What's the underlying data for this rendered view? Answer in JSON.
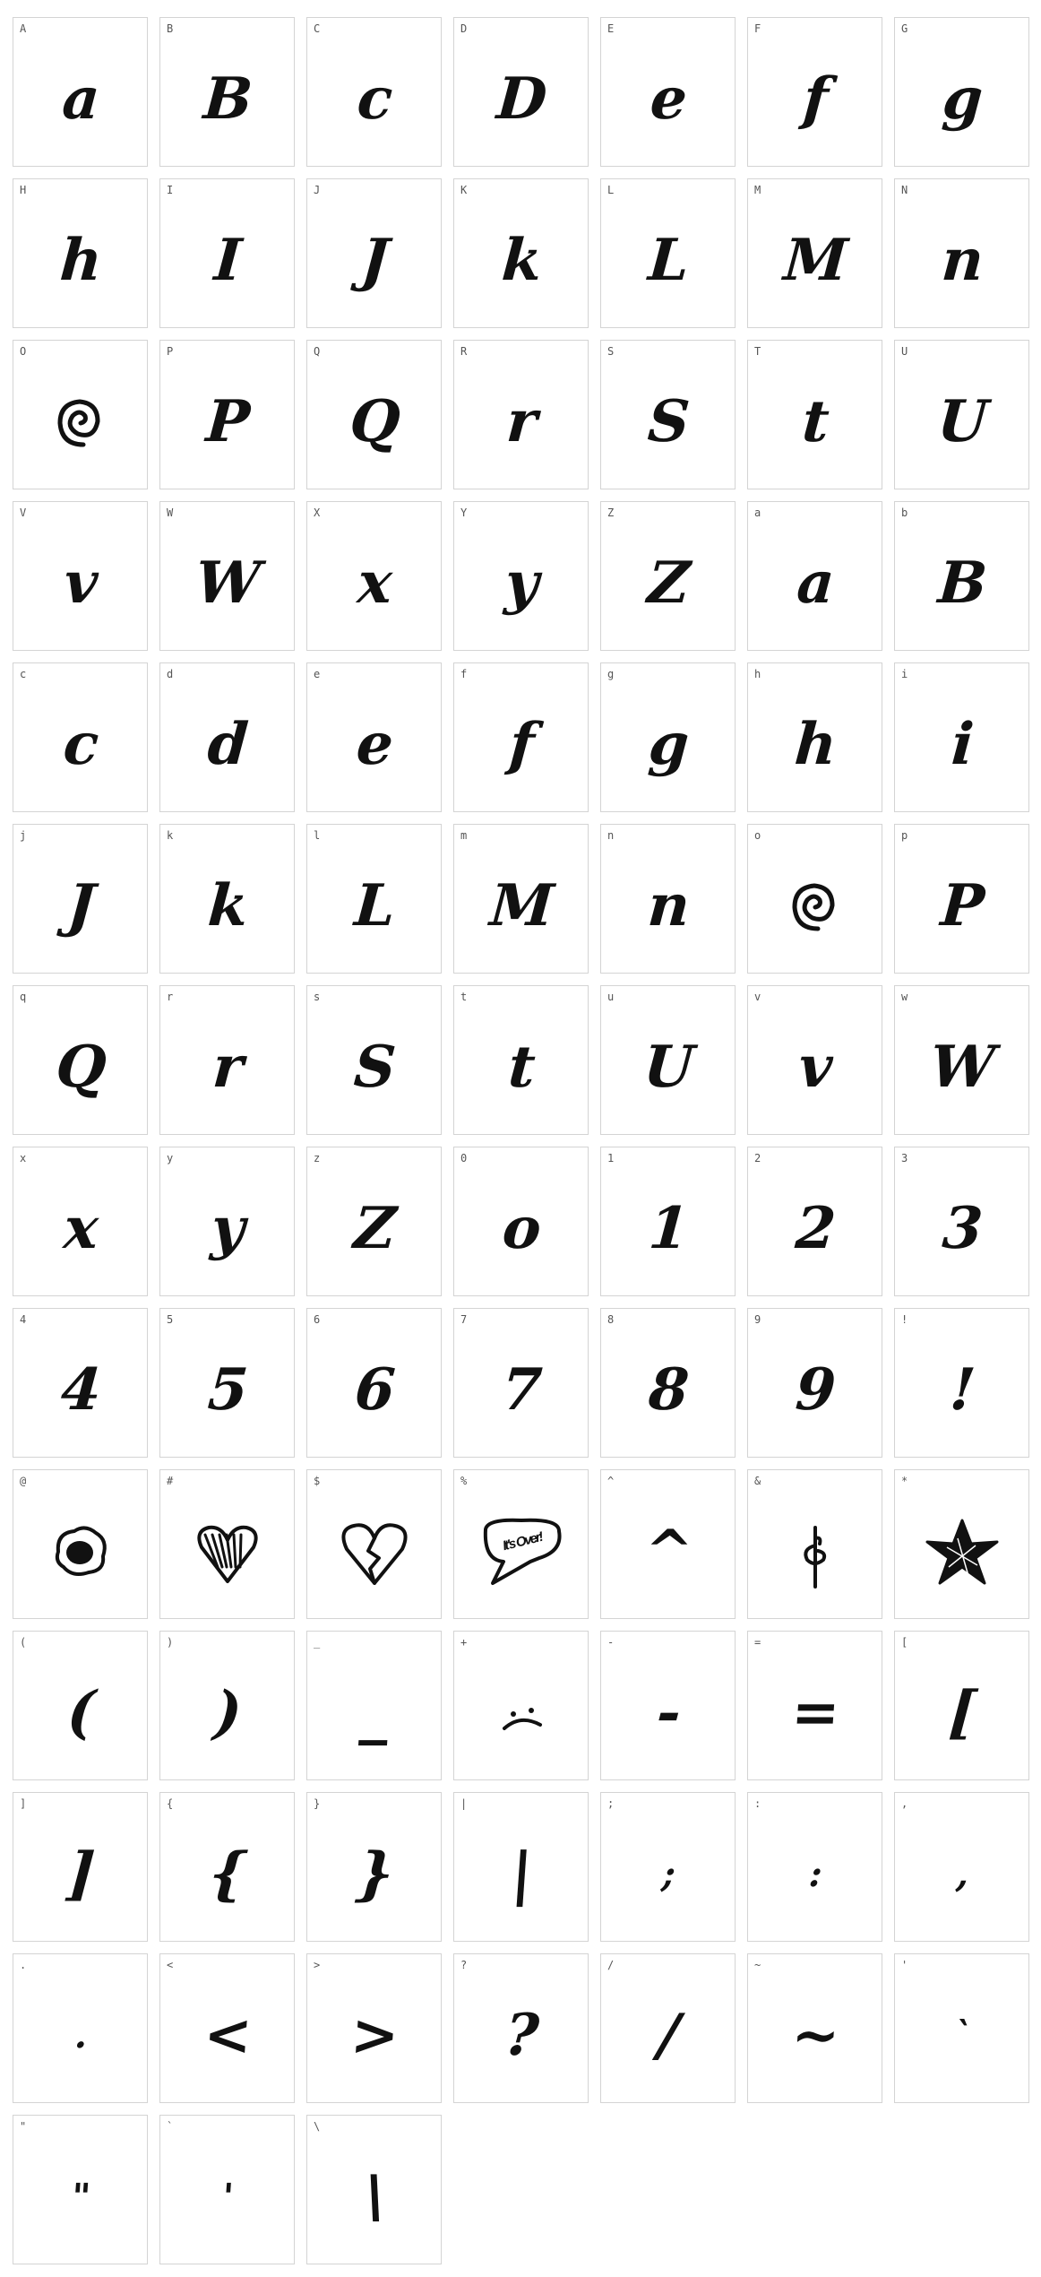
{
  "cells": [
    {
      "label": "A",
      "glyph": "a"
    },
    {
      "label": "B",
      "glyph": "B"
    },
    {
      "label": "C",
      "glyph": "c"
    },
    {
      "label": "D",
      "glyph": "D",
      "style": "hatched"
    },
    {
      "label": "E",
      "glyph": "e"
    },
    {
      "label": "F",
      "glyph": "f"
    },
    {
      "label": "G",
      "glyph": "g",
      "style": "scribble"
    },
    {
      "label": "H",
      "glyph": "h"
    },
    {
      "label": "I",
      "glyph": "I"
    },
    {
      "label": "J",
      "glyph": "J"
    },
    {
      "label": "K",
      "glyph": "k"
    },
    {
      "label": "L",
      "glyph": "L"
    },
    {
      "label": "M",
      "glyph": "M"
    },
    {
      "label": "N",
      "glyph": "n"
    },
    {
      "label": "O",
      "glyph": "@",
      "style": "spiral"
    },
    {
      "label": "P",
      "glyph": "P"
    },
    {
      "label": "Q",
      "glyph": "Q",
      "style": "hatched"
    },
    {
      "label": "R",
      "glyph": "r"
    },
    {
      "label": "S",
      "glyph": "S"
    },
    {
      "label": "T",
      "glyph": "t"
    },
    {
      "label": "U",
      "glyph": "U",
      "style": "hatched"
    },
    {
      "label": "V",
      "glyph": "v"
    },
    {
      "label": "W",
      "glyph": "W"
    },
    {
      "label": "X",
      "glyph": "x"
    },
    {
      "label": "Y",
      "glyph": "y"
    },
    {
      "label": "Z",
      "glyph": "Z",
      "style": "striped"
    },
    {
      "label": "a",
      "glyph": "a"
    },
    {
      "label": "b",
      "glyph": "B"
    },
    {
      "label": "c",
      "glyph": "c"
    },
    {
      "label": "d",
      "glyph": "d"
    },
    {
      "label": "e",
      "glyph": "e"
    },
    {
      "label": "f",
      "glyph": "f"
    },
    {
      "label": "g",
      "glyph": "g"
    },
    {
      "label": "h",
      "glyph": "h"
    },
    {
      "label": "i",
      "glyph": "i"
    },
    {
      "label": "j",
      "glyph": "J"
    },
    {
      "label": "k",
      "glyph": "k"
    },
    {
      "label": "l",
      "glyph": "L"
    },
    {
      "label": "m",
      "glyph": "M"
    },
    {
      "label": "n",
      "glyph": "n"
    },
    {
      "label": "o",
      "glyph": "@",
      "style": "spiral"
    },
    {
      "label": "p",
      "glyph": "P"
    },
    {
      "label": "q",
      "glyph": "Q",
      "style": "hatched"
    },
    {
      "label": "r",
      "glyph": "r"
    },
    {
      "label": "s",
      "glyph": "S"
    },
    {
      "label": "t",
      "glyph": "t"
    },
    {
      "label": "u",
      "glyph": "U",
      "style": "hatched"
    },
    {
      "label": "v",
      "glyph": "v"
    },
    {
      "label": "w",
      "glyph": "W"
    },
    {
      "label": "x",
      "glyph": "x"
    },
    {
      "label": "y",
      "glyph": "y"
    },
    {
      "label": "z",
      "glyph": "Z",
      "style": "striped"
    },
    {
      "label": "0",
      "glyph": "o"
    },
    {
      "label": "1",
      "glyph": "1"
    },
    {
      "label": "2",
      "glyph": "2"
    },
    {
      "label": "3",
      "glyph": "3"
    },
    {
      "label": "4",
      "glyph": "4"
    },
    {
      "label": "5",
      "glyph": "5"
    },
    {
      "label": "6",
      "glyph": "6"
    },
    {
      "label": "7",
      "glyph": "7"
    },
    {
      "label": "8",
      "glyph": "8"
    },
    {
      "label": "9",
      "glyph": "9"
    },
    {
      "label": "!",
      "glyph": "!"
    },
    {
      "label": "@",
      "glyph": "",
      "style": "egg-icon"
    },
    {
      "label": "#",
      "glyph": "",
      "style": "heart-hatched-icon"
    },
    {
      "label": "$",
      "glyph": "",
      "style": "broken-heart-icon"
    },
    {
      "label": "%",
      "glyph": "It's Over!",
      "style": "speech-bubble-icon"
    },
    {
      "label": "^",
      "glyph": "^"
    },
    {
      "label": "&",
      "glyph": "",
      "style": "rose-icon"
    },
    {
      "label": "*",
      "glyph": "",
      "style": "scribble-star-icon"
    },
    {
      "label": "(",
      "glyph": "("
    },
    {
      "label": ")",
      "glyph": ")"
    },
    {
      "label": "_",
      "glyph": "_"
    },
    {
      "label": "+",
      "glyph": "",
      "style": "sad-face-icon"
    },
    {
      "label": "-",
      "glyph": "-"
    },
    {
      "label": "=",
      "glyph": "="
    },
    {
      "label": "[",
      "glyph": "["
    },
    {
      "label": "]",
      "glyph": "]"
    },
    {
      "label": "{",
      "glyph": "{"
    },
    {
      "label": "}",
      "glyph": "}"
    },
    {
      "label": "|",
      "glyph": "|"
    },
    {
      "label": ";",
      "glyph": ";"
    },
    {
      "label": ":",
      "glyph": ":"
    },
    {
      "label": ",",
      "glyph": ","
    },
    {
      "label": ".",
      "glyph": "."
    },
    {
      "label": "<",
      "glyph": "<"
    },
    {
      "label": ">",
      "glyph": ">"
    },
    {
      "label": "?",
      "glyph": "?"
    },
    {
      "label": "/",
      "glyph": "/"
    },
    {
      "label": "~",
      "glyph": "~"
    },
    {
      "label": "'",
      "glyph": "`"
    },
    {
      "label": "\"",
      "glyph": "\""
    },
    {
      "label": "`",
      "glyph": "'"
    },
    {
      "label": "\\",
      "glyph": "\\"
    }
  ],
  "colors": {
    "background": "#ffffff",
    "cell_border": "#d4d4d4",
    "label": "#555555",
    "glyph": "#111111"
  }
}
